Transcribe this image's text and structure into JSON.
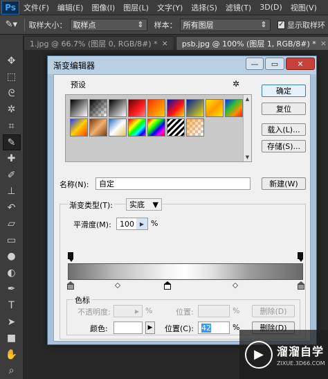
{
  "app": {
    "logo": "Ps",
    "menu": [
      "文件(F)",
      "编辑(E)",
      "图像(I)",
      "图层(L)",
      "文字(Y)",
      "选择(S)",
      "滤镜(T)",
      "3D(D)",
      "视图(V)"
    ]
  },
  "options_bar": {
    "sample_size_label": "取样大小：",
    "sample_size_value": "取样点",
    "sample_label": "样本：",
    "sample_value": "所有图层",
    "show_ring_label": "显示取样环",
    "show_ring_checked": true
  },
  "tabs": [
    {
      "label": "1.jpg @ 66.7% (图层 0, RGB/8#) *",
      "active": false
    },
    {
      "label": "psb.jpg @ 100% (图层 1, RGB/8#) *",
      "active": true
    }
  ],
  "tools": [
    "move-icon",
    "marquee-icon",
    "lasso-icon",
    "magic-wand-icon",
    "crop-icon",
    "eyedropper-icon",
    "healing-icon",
    "brush-icon",
    "stamp-icon",
    "history-brush-icon",
    "eraser-icon",
    "gradient-icon",
    "blur-icon",
    "dodge-icon",
    "pen-icon",
    "type-icon",
    "path-select-icon",
    "shape-icon",
    "hand-icon",
    "zoom-icon"
  ],
  "dialog": {
    "title": "渐变编辑器",
    "presets_label": "预设",
    "buttons": {
      "ok": "确定",
      "reset": "复位",
      "load": "载入(L)...",
      "save": "存储(S)...",
      "new": "新建(W)",
      "delete_opacity": "删除(D)",
      "delete_color": "删除(D)"
    },
    "name_label": "名称(N):",
    "name_value": "自定",
    "gradient_type_label": "渐变类型(T):",
    "gradient_type_value": "实底",
    "smoothness_label": "平滑度(M):",
    "smoothness_value": "100",
    "percent": "%",
    "stops_group_label": "色标",
    "opacity_label": "不透明度:",
    "opacity_value": "",
    "location_label_disabled": "位置:",
    "location_value_disabled": "",
    "color_label": "颜色:",
    "location_label": "位置(C):",
    "location_value": "42"
  },
  "watermark": {
    "main": "溜溜自学",
    "sub": "ZIXUE.3D66.COM"
  }
}
